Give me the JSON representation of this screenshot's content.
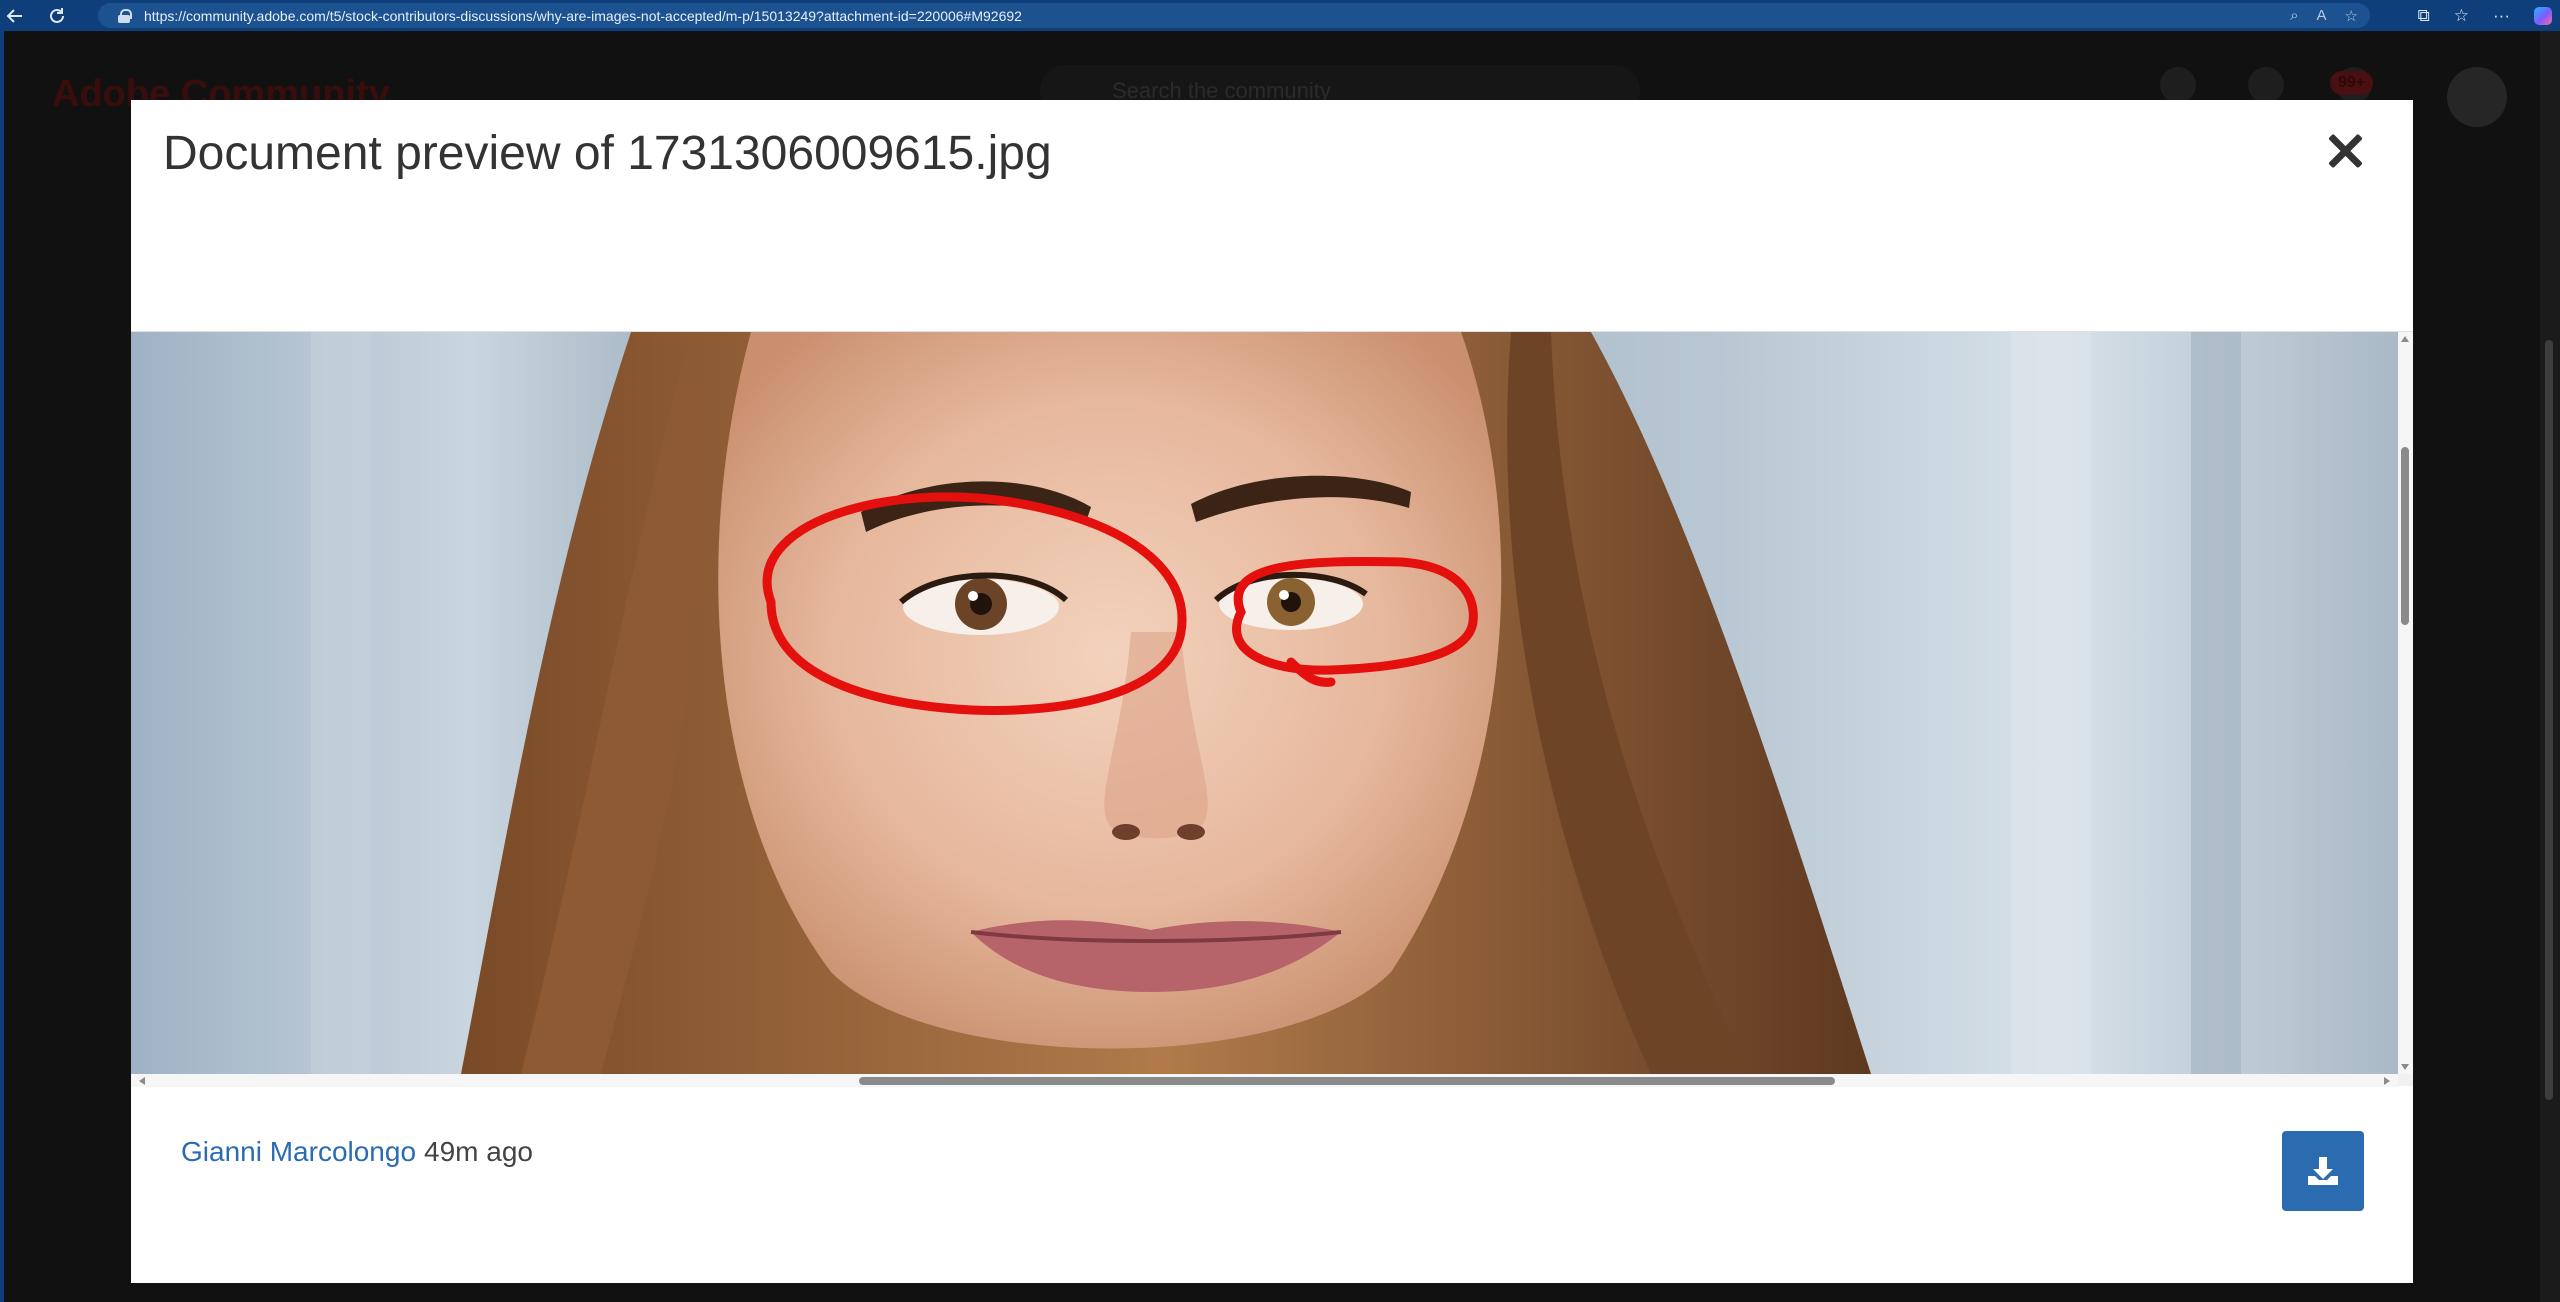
{
  "browser": {
    "url": "https://community.adobe.com/t5/stock-contributors-discussions/why-are-images-not-accepted/m-p/15013249?attachment-id=220006#M92692",
    "back_icon": "back-arrow-icon",
    "refresh_icon": "refresh-icon",
    "accent": "#0f3f7a"
  },
  "background_page": {
    "logo": "Adobe Community",
    "search_placeholder": "Search the community",
    "notification_badge": "99+"
  },
  "modal": {
    "title": "Document preview of 1731306009615.jpg",
    "close_icon": "close-icon",
    "author": "Gianni Marcolongo",
    "time": "49m ago",
    "download_icon": "download-icon",
    "accent": "#2b6cb0"
  }
}
